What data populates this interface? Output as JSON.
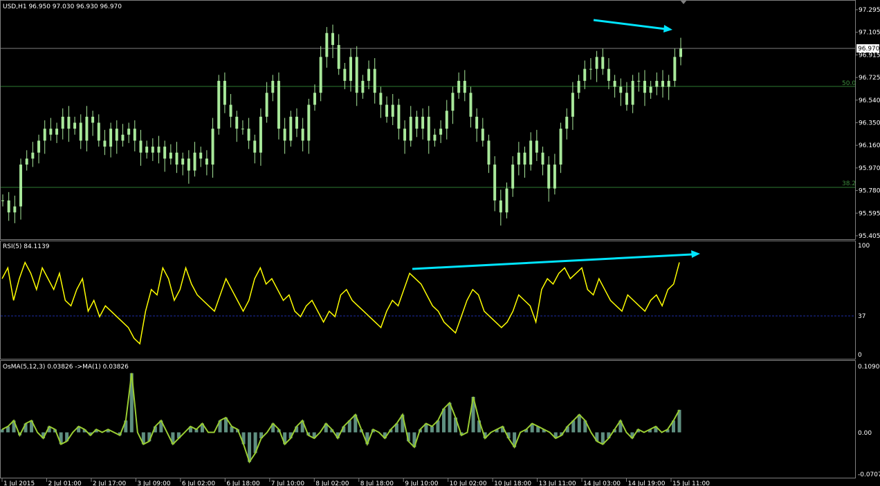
{
  "main_panel": {
    "header": "USD,H1  96.950 97.030 96.930 96.970",
    "y_ticks": [
      "97.295",
      "97.105",
      "96.915",
      "96.725",
      "96.540",
      "96.350",
      "96.160",
      "95.970",
      "95.780",
      "95.595",
      "95.405"
    ],
    "price_label": "96.970",
    "fib_labels": [
      "50.0",
      "38.2"
    ]
  },
  "rsi_panel": {
    "header": "RSI(5) 84.1139",
    "y_ticks": [
      "100",
      "37",
      "0"
    ]
  },
  "osma_panel": {
    "header": "OsMA(5,12,3) 0.03826  ->MA(1) 0.03826",
    "y_ticks": [
      "0.10902",
      "0.00",
      "-0.0707"
    ]
  },
  "x_axis": {
    "labels": [
      "1 Jul 2015",
      "2 Jul 01:00",
      "2 Jul 17:00",
      "3 Jul 09:00",
      "6 Jul 02:00",
      "6 Jul 18:00",
      "7 Jul 10:00",
      "8 Jul 02:00",
      "8 Jul 18:00",
      "9 Jul 10:00",
      "10 Jul 02:00",
      "10 Jul 18:00",
      "13 Jul 11:00",
      "14 Jul 03:00",
      "14 Jul 19:00",
      "15 Jul 11:00"
    ]
  },
  "colors": {
    "background": "#000000",
    "candles": "#a8e89a",
    "rsi_line": "#ffff00",
    "osma_line": "#9acd32",
    "osma_bars": "#5f8f80",
    "trend_arrows": "#00e5ff",
    "grid": "#808080",
    "fib_lines": "#2e7d32",
    "rsi_level": "#1e2ea8"
  },
  "chart_data": [
    {
      "type": "candlestick",
      "title": "USD,H1",
      "ylim": [
        95.405,
        97.295
      ],
      "close": [
        95.7,
        95.6,
        95.65,
        96,
        96.05,
        96.1,
        96.2,
        96.3,
        96.25,
        96.3,
        96.4,
        96.3,
        96.35,
        96.2,
        96.4,
        96.35,
        96.2,
        96.15,
        96.3,
        96.2,
        96.25,
        96.3,
        96.2,
        96.1,
        96.15,
        96.1,
        96.15,
        96.05,
        96.1,
        96.0,
        96.05,
        95.95,
        96.1,
        96.05,
        96.0,
        96.3,
        96.7,
        96.5,
        96.4,
        96.3,
        96.3,
        96.2,
        96.1,
        96.4,
        96.6,
        96.7,
        96.3,
        96.2,
        96.4,
        96.3,
        96.2,
        96.5,
        96.6,
        96.9,
        97.1,
        97.0,
        96.8,
        96.7,
        96.9,
        96.6,
        96.7,
        96.8,
        96.6,
        96.5,
        96.4,
        96.5,
        96.3,
        96.2,
        96.4,
        96.3,
        96.4,
        96.2,
        96.25,
        96.3,
        96.45,
        96.6,
        96.7,
        96.6,
        96.4,
        96.3,
        96.2,
        96.0,
        95.7,
        95.6,
        95.8,
        96.0,
        96.1,
        96.0,
        96.2,
        96.1,
        96.0,
        95.8,
        96.0,
        96.3,
        96.4,
        96.6,
        96.7,
        96.8,
        96.8,
        96.9,
        96.8,
        96.7,
        96.65,
        96.6,
        96.5,
        96.7,
        96.7,
        96.6,
        96.65,
        96.7,
        96.65,
        96.7,
        96.9,
        96.97
      ],
      "last": {
        "open": 96.95,
        "high": 97.03,
        "low": 96.93,
        "close": 96.97
      },
      "fibonacci_levels": [
        {
          "label": "50.0",
          "price": 96.66
        },
        {
          "label": "38.2",
          "price": 95.8
        }
      ],
      "horizontal_line_price": 96.97
    },
    {
      "type": "line",
      "title": "RSI(5) 84.1139",
      "ylim": [
        0,
        100
      ],
      "level": 37,
      "series": [
        {
          "values": [
            70,
            80,
            50,
            70,
            85,
            75,
            60,
            80,
            70,
            60,
            75,
            50,
            45,
            60,
            70,
            40,
            50,
            35,
            45,
            40,
            35,
            30,
            25,
            15,
            10,
            40,
            60,
            55,
            80,
            70,
            50,
            60,
            80,
            65,
            55,
            50,
            45,
            40,
            55,
            70,
            60,
            50,
            40,
            50,
            70,
            80,
            65,
            70,
            60,
            50,
            55,
            40,
            35,
            45,
            50,
            40,
            30,
            40,
            35,
            55,
            60,
            50,
            45,
            40,
            35,
            30,
            25,
            40,
            50,
            45,
            60,
            75,
            70,
            65,
            55,
            45,
            40,
            30,
            25,
            20,
            35,
            50,
            60,
            55,
            40,
            35,
            30,
            25,
            30,
            40,
            55,
            50,
            45,
            30,
            60,
            70,
            65,
            75,
            80,
            70,
            75,
            80,
            60,
            55,
            70,
            60,
            50,
            45,
            40,
            55,
            50,
            45,
            40,
            50,
            55,
            45,
            60,
            65,
            85
          ]
        }
      ]
    },
    {
      "type": "area",
      "title": "OsMA(5,12,3) 0.03826",
      "ylim": [
        -0.0707,
        0.10902
      ],
      "series": [
        {
          "values": [
            0.005,
            0.01,
            0.02,
            -0.005,
            0.015,
            0.02,
            0.0,
            -0.01,
            0.01,
            0.005,
            -0.02,
            -0.015,
            0.0,
            0.01,
            0.005,
            -0.005,
            0.005,
            0.0,
            0.005,
            0.0,
            -0.005,
            0.02,
            0.1,
            0.0,
            -0.02,
            -0.015,
            0.01,
            0.02,
            0.0,
            -0.02,
            -0.01,
            0.0,
            0.01,
            0.005,
            0.015,
            0.0,
            0.0,
            0.02,
            0.025,
            0.01,
            0.005,
            -0.02,
            -0.05,
            -0.035,
            -0.01,
            0.0,
            0.015,
            0.005,
            -0.02,
            -0.01,
            0.01,
            0.02,
            -0.005,
            -0.01,
            0.0,
            0.015,
            0.005,
            -0.01,
            0.01,
            0.02,
            0.03,
            0.005,
            -0.02,
            0.005,
            0.0,
            -0.01,
            0.005,
            0.015,
            0.03,
            -0.015,
            -0.025,
            0.005,
            0.015,
            0.01,
            0.02,
            0.04,
            0.05,
            0.025,
            -0.005,
            0.0,
            0.06,
            0.02,
            -0.01,
            0.0,
            0.005,
            0.01,
            -0.01,
            -0.025,
            0.0,
            0.005,
            0.015,
            0.01,
            0.005,
            0.0,
            -0.01,
            -0.005,
            0.01,
            0.02,
            0.03,
            0.02,
            0.0,
            -0.015,
            -0.02,
            -0.01,
            0.005,
            0.02,
            0.0,
            -0.01,
            0.005,
            0.0,
            0.005,
            0.01,
            0.0,
            0.005,
            0.02,
            0.038
          ]
        }
      ]
    }
  ]
}
